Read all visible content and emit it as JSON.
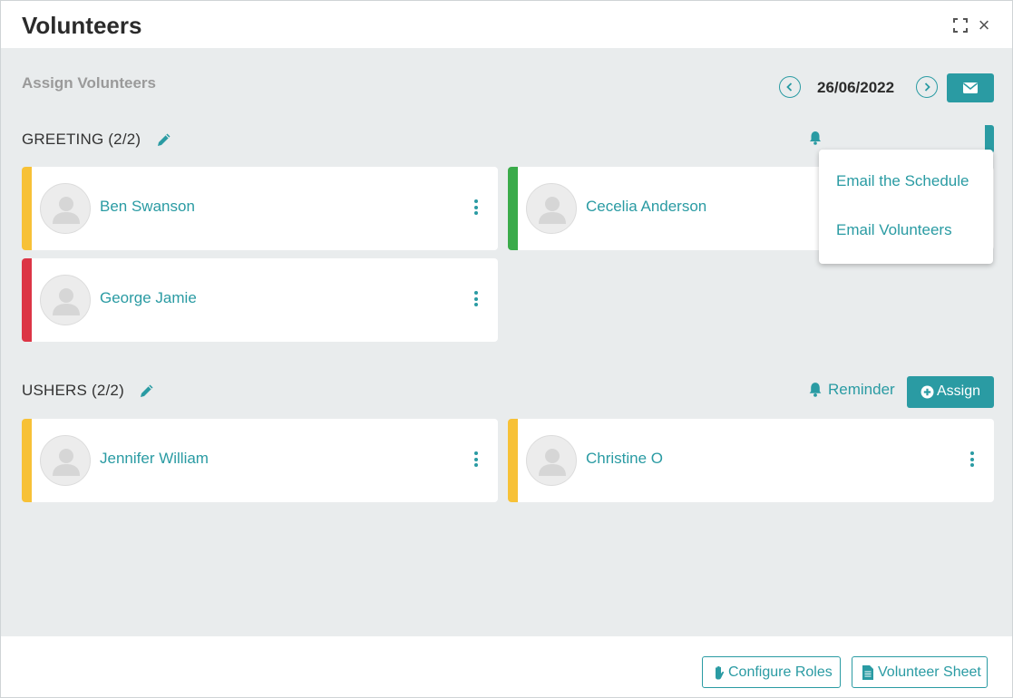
{
  "window": {
    "title": "Volunteers"
  },
  "header": {
    "subtitle": "Assign Volunteers",
    "date": "26/06/2022"
  },
  "email_menu": {
    "items": [
      {
        "label": "Email the Schedule"
      },
      {
        "label": "Email Volunteers"
      }
    ]
  },
  "sections": [
    {
      "title": "GREETING (2/2)",
      "volunteers": [
        {
          "name": "Ben Swanson",
          "status_color": "#f7c137"
        },
        {
          "name": "Cecelia Anderson",
          "status_color": "#3aab4a"
        },
        {
          "name": "George Jamie",
          "status_color": "#dc3545"
        }
      ]
    },
    {
      "title": "USHERS (2/2)",
      "reminder_label": "Reminder",
      "assign_label": "Assign",
      "volunteers": [
        {
          "name": "Jennifer William",
          "status_color": "#f7c137"
        },
        {
          "name": "Christine O",
          "status_color": "#f7c137"
        }
      ]
    }
  ],
  "footer": {
    "configure_roles_label": "Configure Roles",
    "volunteer_sheet_label": "Volunteer Sheet"
  },
  "icons": {
    "expand": "expand-icon",
    "close": "close-icon",
    "prev": "chevron-left-icon",
    "next": "chevron-right-icon",
    "email": "envelope-icon",
    "edit": "pencil-icon",
    "avatar": "user-placeholder-icon",
    "menu": "kebab-icon",
    "bell": "bell-icon",
    "plus": "plus-circle-icon",
    "hand": "hand-icon",
    "file": "file-icon"
  },
  "colors": {
    "accent": "#2a9ba3",
    "background": "#e9eced",
    "yellow": "#f7c137",
    "green": "#3aab4a",
    "red": "#dc3545"
  }
}
